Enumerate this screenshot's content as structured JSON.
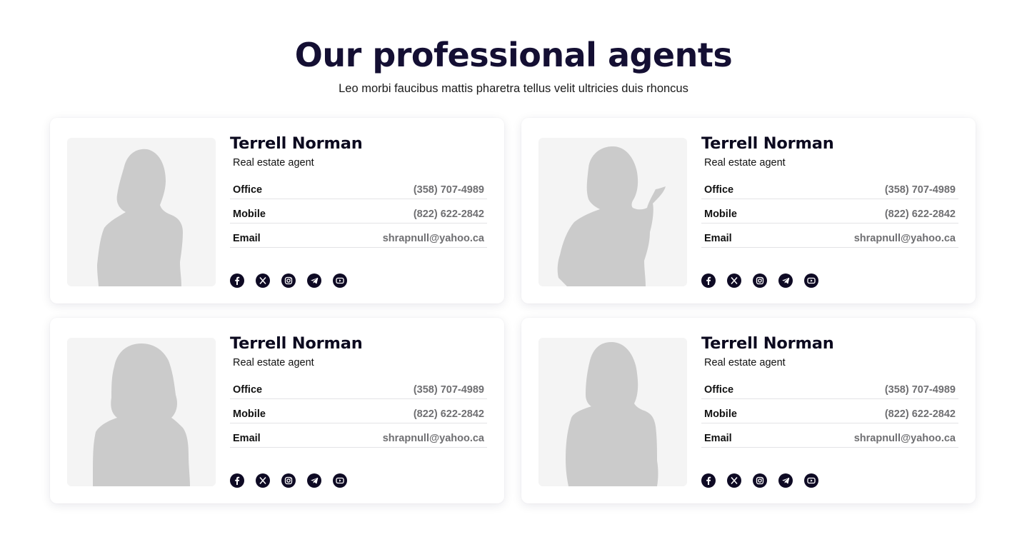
{
  "header": {
    "title": "Our professional agents",
    "subtitle": "Leo morbi faucibus mattis pharetra tellus velit ultricies duis rhoncus"
  },
  "colors": {
    "heading": "#140f33",
    "icon_bg": "#0e0a24",
    "photo_bg": "#f4f4f4",
    "silhouette": "#cbcbcb",
    "muted_value": "#6f6f72"
  },
  "social_icons": [
    "facebook-icon",
    "x-twitter-icon",
    "instagram-icon",
    "telegram-icon",
    "youtube-icon"
  ],
  "agents": [
    {
      "name": "Terrell Norman",
      "role": "Real estate agent",
      "photo_icon": "woman-silhouette-arms-crossed",
      "office_label": "Office",
      "office": "(358) 707-4989",
      "mobile_label": "Mobile",
      "mobile": "(822) 622-2842",
      "email_label": "Email",
      "email": "shrapnull@yahoo.ca"
    },
    {
      "name": "Terrell Norman",
      "role": "Real estate agent",
      "photo_icon": "woman-silhouette-pointing",
      "office_label": "Office",
      "office": "(358) 707-4989",
      "mobile_label": "Mobile",
      "mobile": "(822) 622-2842",
      "email_label": "Email",
      "email": "shrapnull@yahoo.ca"
    },
    {
      "name": "Terrell Norman",
      "role": "Real estate agent",
      "photo_icon": "woman-silhouette-curly-hair",
      "office_label": "Office",
      "office": "(358) 707-4989",
      "mobile_label": "Mobile",
      "mobile": "(822) 622-2842",
      "email_label": "Email",
      "email": "shrapnull@yahoo.ca"
    },
    {
      "name": "Terrell Norman",
      "role": "Real estate agent",
      "photo_icon": "woman-silhouette-standing",
      "office_label": "Office",
      "office": "(358) 707-4989",
      "mobile_label": "Mobile",
      "mobile": "(822) 622-2842",
      "email_label": "Email",
      "email": "shrapnull@yahoo.ca"
    }
  ]
}
